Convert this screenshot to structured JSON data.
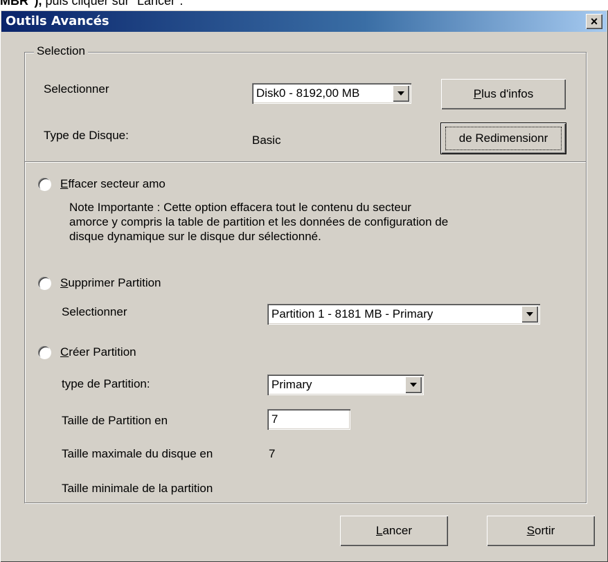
{
  "top_text": {
    "bold": "MBR\"),",
    "rest": " puis cliquer sur \"Lancer\"."
  },
  "window": {
    "title": "Outils Avancés",
    "close_glyph": "×"
  },
  "selection": {
    "group_label": "Selection",
    "select_label": "Selectionner",
    "disk_value": "Disk0 - 8192,00 MB",
    "more_info_mnemonic": "P",
    "more_info_rest": "lus d'infos",
    "disk_type_label": "Type de Disque:",
    "disk_type_value": "Basic",
    "resize_button": "de Redimensionr"
  },
  "erase": {
    "mnemonic": "E",
    "rest": "ffacer secteur amo",
    "note_line1": "Note Importante : Cette option effacera tout le contenu du secteur",
    "note_line2": "amorce y compris la table de partition et les données de configuration de",
    "note_line3": "disque dynamique sur le disque dur sélectionné."
  },
  "delete": {
    "mnemonic": "S",
    "rest": "upprimer Partition",
    "select_label": "Selectionner",
    "partition_value": "Partition 1 - 8181 MB - Primary"
  },
  "create": {
    "mnemonic": "C",
    "rest": "réer Partition",
    "type_label": "type de Partition:",
    "type_value": "Primary",
    "size_label": "Taille de Partition en",
    "size_value": "7",
    "max_label": "Taille maximale du disque en",
    "max_value": "7",
    "min_label": "Taille minimale de la partition"
  },
  "footer": {
    "launch_mnemonic": "L",
    "launch_rest": "ancer",
    "exit_mnemonic": "S",
    "exit_rest": "ortir"
  }
}
